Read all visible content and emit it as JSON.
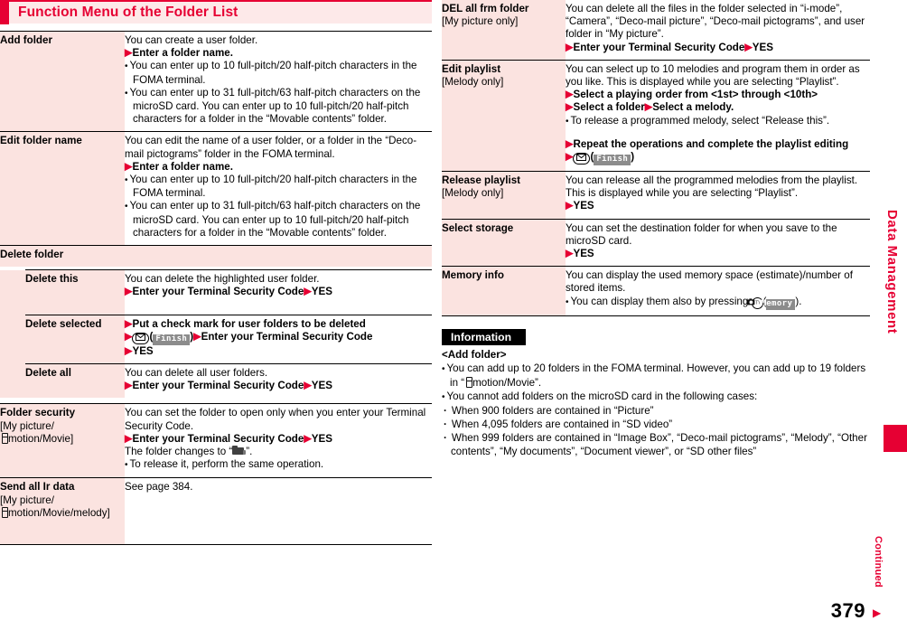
{
  "section": {
    "title": "Function Menu of the Folder List"
  },
  "colors": {
    "accent_red": "#e60033",
    "term_cell_pink": "#fbe3e0",
    "header_band": "#fde9e9",
    "softkey_gray": "#8c8c8c"
  },
  "left_column": {
    "rows": [
      {
        "term": "Add folder",
        "term_sub": "",
        "lines": [
          {
            "kind": "plain",
            "text": "You can create a user folder."
          },
          {
            "kind": "step",
            "text": "Enter a folder name."
          },
          {
            "kind": "bullet",
            "text": "You can enter up to 10 full-pitch/20 half-pitch characters in the FOMA terminal."
          },
          {
            "kind": "bullet",
            "text": "You can enter up to 31 full-pitch/63 half-pitch characters on the microSD card. You can enter up to 10 full-pitch/20 half-pitch characters for a folder in the “Movable contents” folder."
          }
        ]
      },
      {
        "term": "Edit folder name",
        "term_sub": "",
        "lines": [
          {
            "kind": "plain",
            "text": "You can edit the name of a user folder, or a folder in the “Deco-mail pictograms” folder in the FOMA terminal."
          },
          {
            "kind": "step",
            "text": "Enter a folder name."
          },
          {
            "kind": "bullet",
            "text": "You can enter up to 10 full-pitch/20 half-pitch characters in the FOMA terminal."
          },
          {
            "kind": "bullet",
            "text": "You can enter up to 31 full-pitch/63 half-pitch characters on the microSD card. You can enter up to 10 full-pitch/20 half-pitch characters for a folder in the “Movable contents” folder."
          }
        ]
      }
    ],
    "delete_folder": {
      "group_title": "Delete folder",
      "children": [
        {
          "term": "Delete this",
          "lines": [
            {
              "kind": "plain",
              "text": "You can delete the highlighted user folder."
            },
            {
              "kind": "step2",
              "text1": "Enter your Terminal Security Code",
              "text2": "YES"
            }
          ]
        },
        {
          "term": "Delete selected",
          "lines": [
            {
              "kind": "step",
              "text": "Put a check mark for user folders to be deleted"
            },
            {
              "kind": "key_finish_then",
              "text": "Enter your Terminal Security Code"
            },
            {
              "kind": "step",
              "text": "YES"
            }
          ]
        },
        {
          "term": "Delete all",
          "lines": [
            {
              "kind": "plain",
              "text": "You can delete all user folders."
            },
            {
              "kind": "step2",
              "text1": "Enter your Terminal Security Code",
              "text2": "YES"
            }
          ]
        }
      ]
    },
    "rows_after": [
      {
        "term": "Folder security",
        "term_sub_1": "[My picture/",
        "term_sub_2": "motion/Movie]",
        "lines": [
          {
            "kind": "plain",
            "text": "You can set the folder to open only when you enter your Terminal Security Code."
          },
          {
            "kind": "step2",
            "text1": "Enter your Terminal Security Code",
            "text2": "YES"
          },
          {
            "kind": "folder_change",
            "prefix": "The folder changes to “",
            "suffix": "”."
          },
          {
            "kind": "bullet",
            "text": "To release it, perform the same operation."
          }
        ]
      },
      {
        "term": "Send all Ir data",
        "term_sub_1": "[My picture/",
        "term_sub_2": "motion/Movie/melody]",
        "lines": [
          {
            "kind": "plain",
            "text": "See page 384."
          }
        ]
      }
    ]
  },
  "right_column": {
    "rows": [
      {
        "term": "DEL all frm folder",
        "term_sub_1": "[My picture only]",
        "term_sub_2": "",
        "lines": [
          {
            "kind": "plain",
            "text": "You can delete all the files in the folder selected in “i-mode”, “Camera”, “Deco-mail picture”, “Deco-mail pictograms”, and user folder in “My picture”."
          },
          {
            "kind": "step2",
            "text1": "Enter your Terminal Security Code",
            "text2": "YES"
          }
        ]
      },
      {
        "term": "Edit playlist",
        "term_sub_1": "[Melody only]",
        "term_sub_2": "",
        "lines": [
          {
            "kind": "plain",
            "text": "You can select up to 10 melodies and program them in order as you like. This is displayed while you are selecting “Playlist”."
          },
          {
            "kind": "step",
            "text": "Select a playing order from <1st> through <10th>"
          },
          {
            "kind": "step2",
            "text1": "Select a folder",
            "text2": "Select a melody."
          },
          {
            "kind": "bullet",
            "text": "To release a programmed melody, select “Release this”."
          },
          {
            "kind": "spacer",
            "text": ""
          },
          {
            "kind": "step",
            "text": "Repeat the operations and complete the playlist editing"
          },
          {
            "kind": "key_finish_only",
            "text": ""
          }
        ]
      },
      {
        "term": "Release playlist",
        "term_sub_1": "[Melody only]",
        "term_sub_2": "",
        "lines": [
          {
            "kind": "plain",
            "text": "You can release all the programmed melodies from the playlist. This is displayed while you are selecting “Playlist”."
          },
          {
            "kind": "step",
            "text": "YES"
          }
        ]
      },
      {
        "term": "Select storage",
        "term_sub_1": "",
        "term_sub_2": "",
        "lines": [
          {
            "kind": "plain",
            "text": "You can set the destination folder for when you save to the microSD card."
          },
          {
            "kind": "step",
            "text": "YES"
          }
        ]
      },
      {
        "term": "Memory info",
        "term_sub_1": "",
        "term_sub_2": "",
        "lines": [
          {
            "kind": "plain",
            "text": "You can display the used memory space (estimate)/number of stored items."
          },
          {
            "kind": "bullet_key_memory",
            "prefix": "You can display them also by pressing ",
            "suffix": ")."
          }
        ]
      }
    ],
    "information": {
      "heading": "Information",
      "subheading": "<Add folder>",
      "items": [
        {
          "kind": "bullet_imode",
          "pre": "You can add up to 20 folders in the FOMA terminal. However, you can add up to 19 folders in “",
          "post": "motion/Movie”."
        },
        {
          "kind": "bullet",
          "text": "You cannot add folders on the microSD card in the following cases:"
        },
        {
          "kind": "dot",
          "text": "When 900 folders are contained in “Picture”"
        },
        {
          "kind": "dot",
          "text": "When 4,095 folders are contained in “SD video”"
        },
        {
          "kind": "dot",
          "text": "When 999 folders are contained in “Image Box”, “Deco-mail pictograms”, “Melody”, “Other contents”, “My documents”, “Document viewer”, or “SD other files”"
        }
      ]
    }
  },
  "side_tab": {
    "label": "Data Management"
  },
  "footer": {
    "page_number": "379",
    "continued_label": "Continued",
    "continued_arrow": "→"
  },
  "softkeys": {
    "finish": "Finish",
    "memory": "Memory"
  }
}
